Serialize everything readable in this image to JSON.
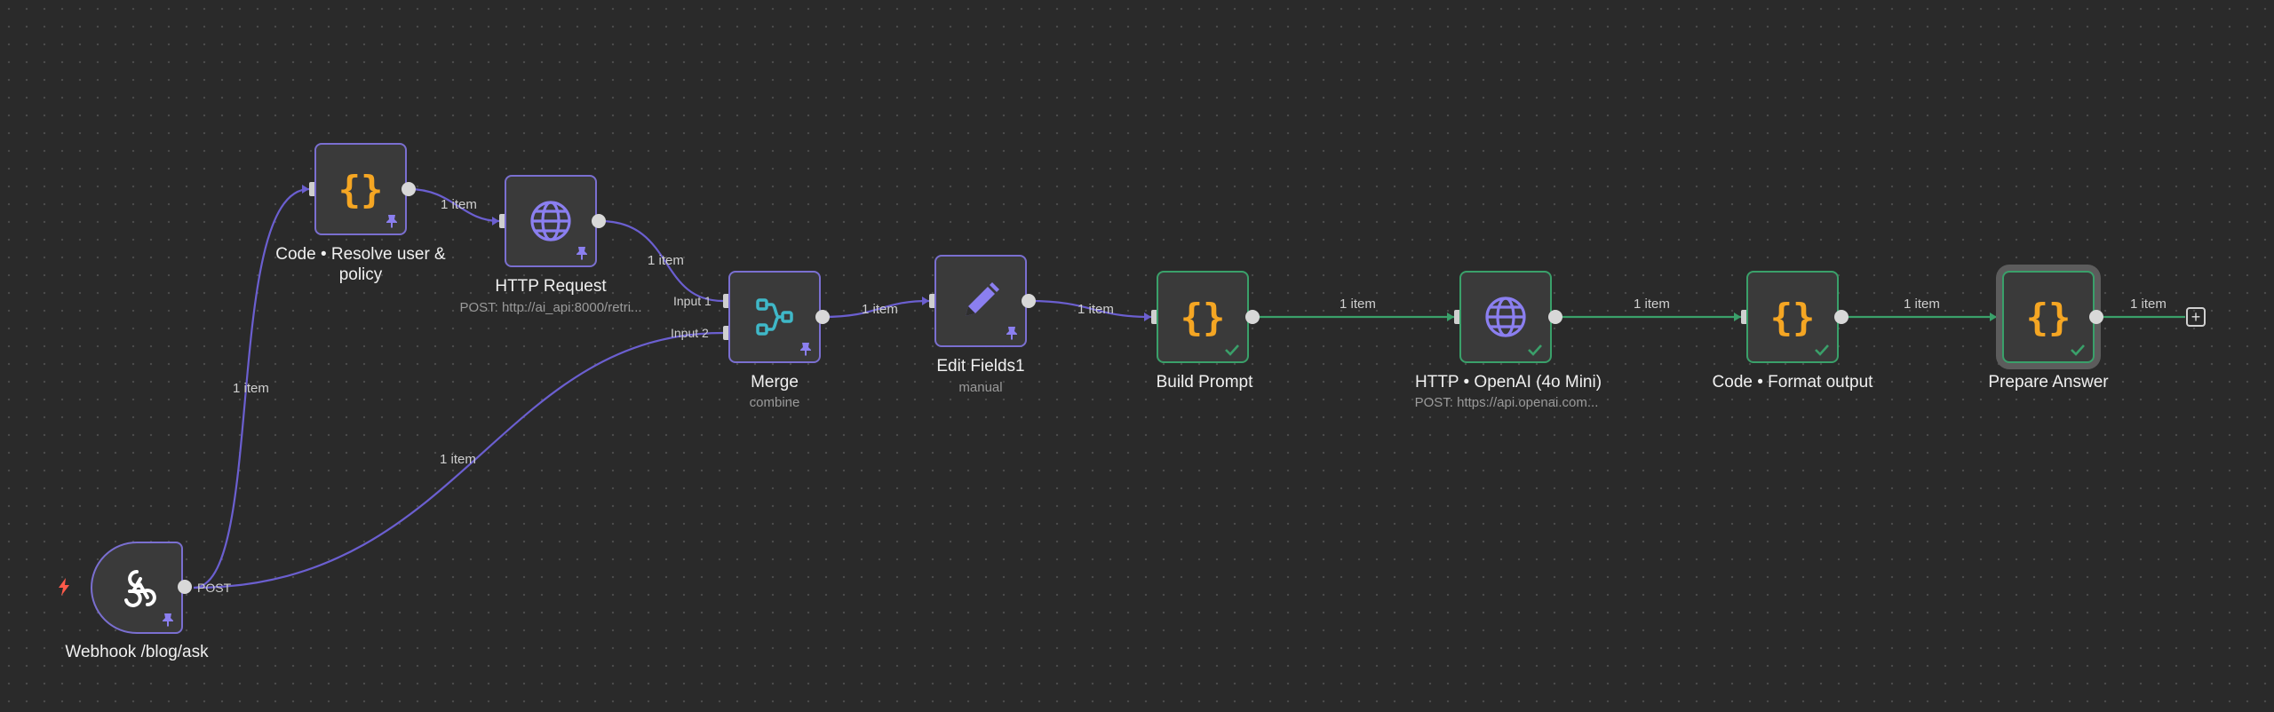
{
  "nodes": {
    "webhook": {
      "title": "Webhook /blog/ask",
      "port": "POST",
      "icon": "webhook-icon"
    },
    "code_resolve": {
      "title": "Code • Resolve user & policy",
      "icon": "code-braces-icon"
    },
    "http_request": {
      "title": "HTTP Request",
      "subtitle": "POST: http://ai_api:8000/retri...",
      "icon": "globe-icon"
    },
    "merge": {
      "title": "Merge",
      "subtitle": "combine",
      "input1": "Input 1",
      "input2": "Input 2",
      "icon": "merge-icon"
    },
    "edit_fields": {
      "title": "Edit Fields1",
      "subtitle": "manual",
      "icon": "pencil-icon"
    },
    "build_prompt": {
      "title": "Build Prompt",
      "icon": "code-braces-icon"
    },
    "http_openai": {
      "title": "HTTP • OpenAI (4o Mini)",
      "subtitle": "POST: https://api.openai.com...",
      "icon": "globe-icon"
    },
    "code_format": {
      "title": "Code • Format output",
      "icon": "code-braces-icon"
    },
    "prepare_answer": {
      "title": "Prepare Answer",
      "icon": "code-braces-icon"
    }
  },
  "edges": {
    "webhook_to_code": "1 item",
    "webhook_to_merge": "1 item",
    "code_to_http": "1 item",
    "http_to_merge": "1 item",
    "merge_to_edit": "1 item",
    "edit_to_build": "1 item",
    "build_to_openai": "1 item",
    "openai_to_format": "1 item",
    "format_to_prepare": "1 item",
    "prepare_to_add": "1 item"
  },
  "add_button": "+",
  "colors": {
    "canvas": "#2a2a2a",
    "node_border_default": "#7a6fd0",
    "node_border_success": "#3aa06a",
    "edge_default": "#6b5fd0",
    "edge_success": "#3aa06a",
    "code_icon": "#f5a623",
    "globe_icon": "#8b7ff0",
    "merge_icon": "#3fb8c8",
    "trigger_bolt": "#ff5a4a"
  }
}
